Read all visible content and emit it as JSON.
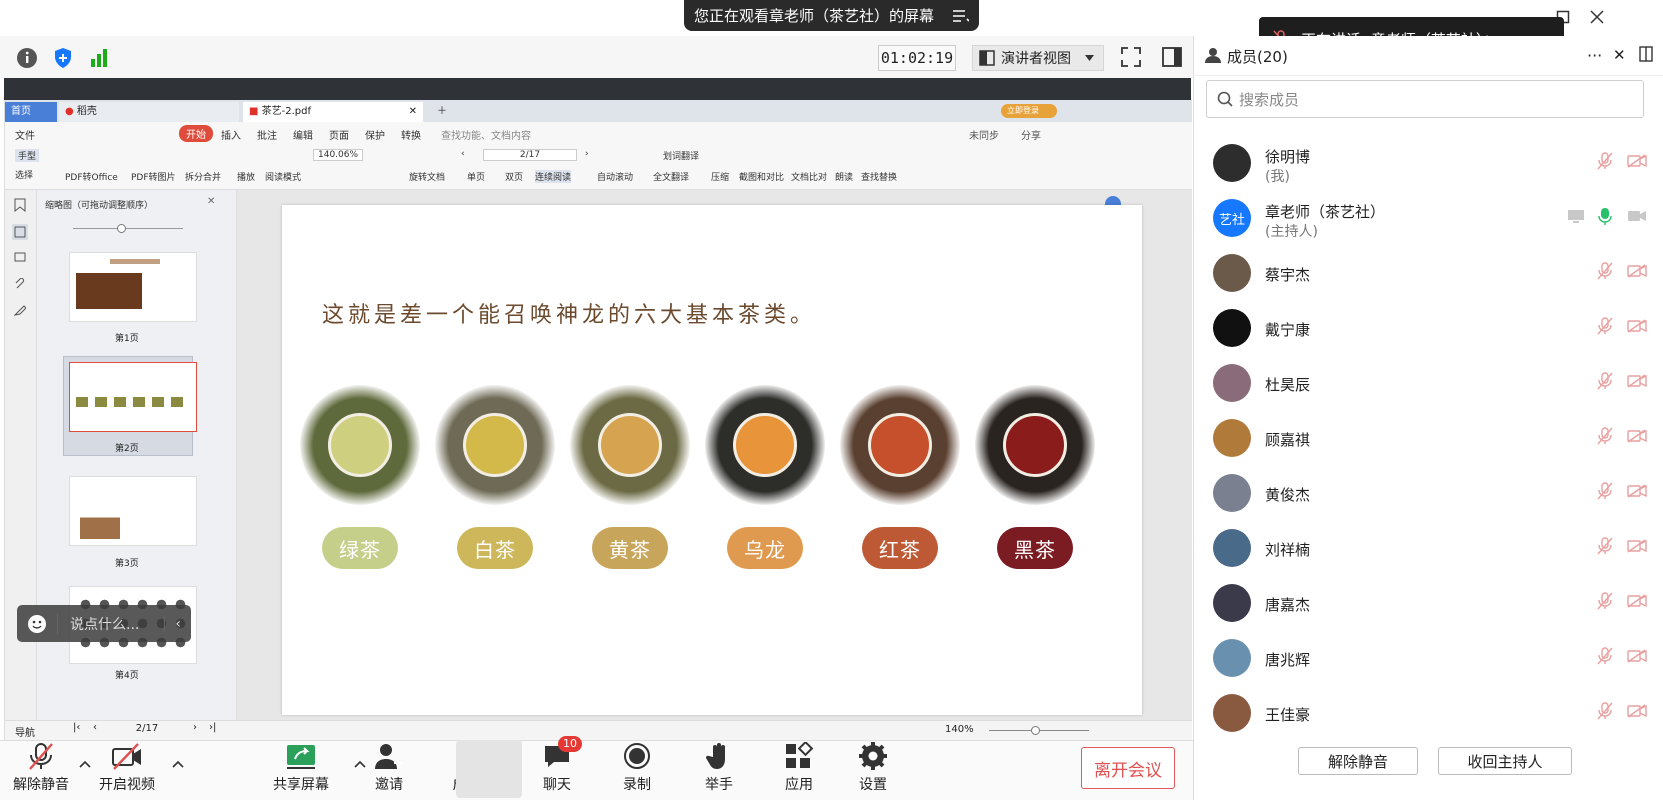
{
  "banner": {
    "text": "您正在观看章老师（茶艺社）的屏幕"
  },
  "speaking": {
    "text": "正在讲话: 章老师（茶艺社）；"
  },
  "toolbar": {
    "timer": "01:02:19",
    "view_label": "演讲者视图"
  },
  "wps": {
    "tabs": [
      {
        "label": "首页"
      },
      {
        "label": "稻壳"
      },
      {
        "label": "茶艺-2.pdf"
      }
    ],
    "login_label": "立即登录",
    "menu": [
      "文件",
      "开始",
      "插入",
      "批注",
      "编辑",
      "页面",
      "保护",
      "转换"
    ],
    "search_placeholder": "查找功能、文档内容",
    "sync_label": "未同步",
    "share_label": "分享",
    "tools": [
      "手型",
      "选择",
      "PDF转Office",
      "PDF转图片",
      "拆分合并",
      "播放",
      "阅读模式",
      "旋转文档",
      "单页",
      "双页",
      "连续阅读",
      "自动滚动",
      "划词翻译",
      "全文翻译",
      "压缩",
      "截图和对比",
      "文档比对",
      "朗读",
      "查找替换"
    ],
    "zoom": "140.06%",
    "page_indicator": "2/17",
    "thumb_title": "缩略图（可拖动调整顺序）",
    "thumb_labels": [
      "第1页",
      "第2页",
      "第3页",
      "第4页"
    ],
    "status": {
      "nav": "导航",
      "page": "2/17",
      "zoom": "140%"
    }
  },
  "slide": {
    "title": "这就是差一个能召唤神龙的六大基本茶类。",
    "teas": [
      {
        "name": "绿茶",
        "leaf": "#5f6a3c",
        "cup": "#cfcf80",
        "pill": "#c6cf8a"
      },
      {
        "name": "白茶",
        "leaf": "#6e6a55",
        "cup": "#d3b84a",
        "pill": "#cdb75a"
      },
      {
        "name": "黄茶",
        "leaf": "#6b6a44",
        "cup": "#d6a450",
        "pill": "#c7a55a"
      },
      {
        "name": "乌龙",
        "leaf": "#2d2d2a",
        "cup": "#e8943b",
        "pill": "#e09a50"
      },
      {
        "name": "红茶",
        "leaf": "#5a4030",
        "cup": "#c6502c",
        "pill": "#bd5a35"
      },
      {
        "name": "黑茶",
        "leaf": "#2a2420",
        "cup": "#8a1c1c",
        "pill": "#7a1c22"
      }
    ]
  },
  "chat_overlay": {
    "placeholder": "说点什么..."
  },
  "bottom": {
    "buttons": [
      {
        "key": "mute",
        "label": "解除静音"
      },
      {
        "key": "video",
        "label": "开启视频"
      },
      {
        "key": "share",
        "label": "共享屏幕"
      },
      {
        "key": "invite",
        "label": "邀请"
      },
      {
        "key": "members",
        "label": "成员(20)"
      },
      {
        "key": "chat",
        "label": "聊天",
        "badge": "10"
      },
      {
        "key": "record",
        "label": "录制"
      },
      {
        "key": "hand",
        "label": "举手"
      },
      {
        "key": "apps",
        "label": "应用"
      },
      {
        "key": "settings",
        "label": "设置"
      }
    ],
    "leave_label": "离开会议"
  },
  "panel": {
    "title": "成员(20)",
    "search_placeholder": "搜索成员",
    "members": [
      {
        "name": "徐明博",
        "sub": "(我)",
        "avatar": "#2d2d2d"
      },
      {
        "name": "章老师（茶艺社）",
        "sub": "(主持人)",
        "avatar": "#1677ff",
        "avatar_text": "艺社"
      },
      {
        "name": "蔡宇杰",
        "avatar": "#6b5a4a"
      },
      {
        "name": "戴宁康",
        "avatar": "#111111"
      },
      {
        "name": "杜昊辰",
        "avatar": "#8a6b7a"
      },
      {
        "name": "顾嘉祺",
        "avatar": "#b07a3a"
      },
      {
        "name": "黄俊杰",
        "avatar": "#7a8090"
      },
      {
        "name": "刘祥楠",
        "avatar": "#4a6a8a"
      },
      {
        "name": "唐嘉杰",
        "avatar": "#3a3a4a"
      },
      {
        "name": "唐兆辉",
        "avatar": "#6a90b0"
      },
      {
        "name": "王佳豪",
        "avatar": "#8a5a40"
      }
    ],
    "unmute_all": "解除静音",
    "reclaim_host": "收回主持人"
  },
  "colors": {
    "accent": "#1677ff",
    "danger": "#e05050",
    "muted_icon": "#e06060",
    "speaking": "#26c26a"
  }
}
